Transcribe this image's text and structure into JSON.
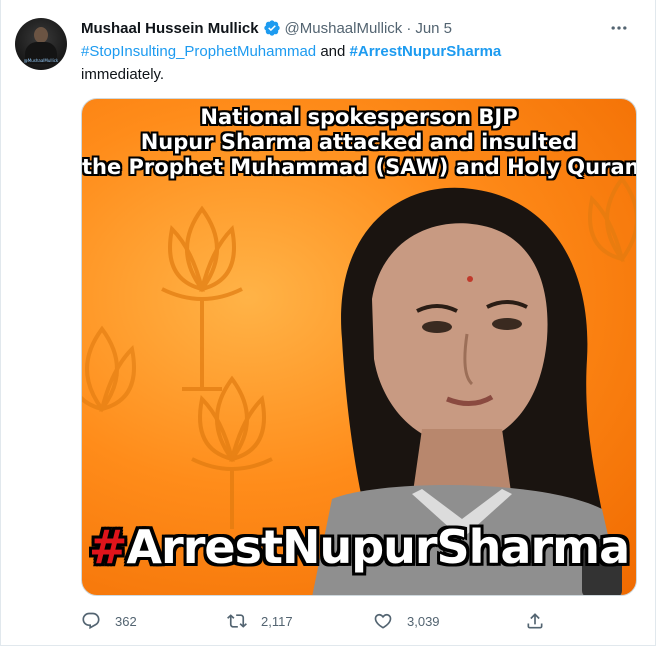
{
  "tweet": {
    "author": {
      "display_name": "Mushaal Hussein Mullick",
      "verified_icon": "verified-badge-icon",
      "handle": "@MushaalMullick",
      "separator": "·",
      "date": "Jun 5",
      "avatar_caption": "@MushaalMullick"
    },
    "text": {
      "hashtag1": "#StopInsulting_ProphetMuhammad",
      "connector": " and ",
      "hashtag2": "#ArrestNupurSharma",
      "rest": "immediately."
    },
    "media": {
      "caption_lines": [
        "National spokesperson BJP",
        "Nupur Sharma attacked and insulted",
        "the Prophet Muhammad (SAW) and Holy Quran"
      ],
      "hashtag_symbol": "#",
      "hashtag_word": "ArrestNupurSharma"
    },
    "actions": {
      "reply": {
        "icon": "reply-icon",
        "count": "362"
      },
      "retweet": {
        "icon": "retweet-icon",
        "count": "2,117"
      },
      "like": {
        "icon": "heart-icon",
        "count": "3,039"
      },
      "share": {
        "icon": "share-icon",
        "count": ""
      }
    },
    "more_icon": "more-options-icon"
  },
  "colors": {
    "link": "#1d9bf0",
    "text": "#0f1419",
    "muted": "#536471",
    "media_orange": "#f57c00",
    "hashtag_red": "#e0141b"
  }
}
